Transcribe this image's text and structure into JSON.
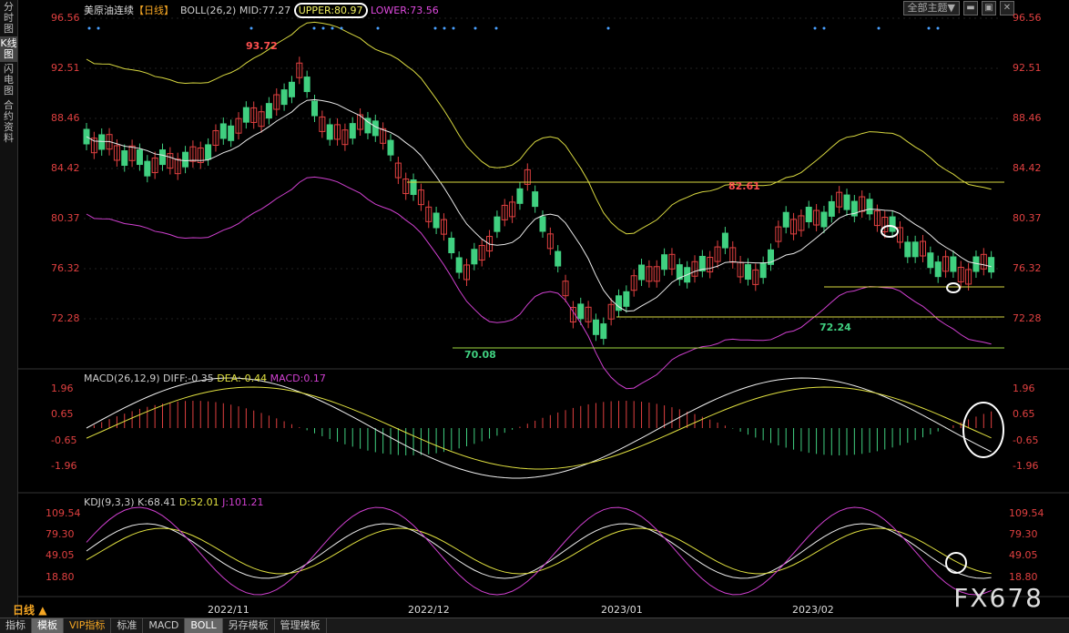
{
  "sidebar": [
    "分时图",
    "K线图",
    "闪电图",
    "合约资料"
  ],
  "header": {
    "symbol": "美原油连续",
    "period_tag": "【日线】",
    "boll": "BOLL(26,2)",
    "mid": "MID:77.27",
    "upper": "UPPER:80.97",
    "lower": "LOWER:73.56",
    "theme_btn": "全部主题▼"
  },
  "price_axis": [
    "96.56",
    "92.51",
    "88.46",
    "84.42",
    "80.37",
    "76.32",
    "72.28"
  ],
  "price_labels": {
    "high": "93.72",
    "mid_high": "82.61",
    "low": "70.08",
    "low2": "72.24"
  },
  "macd": {
    "title": "MACD(26,12,9)",
    "diff": "DIFF:-0.35",
    "dea": "DEA:-0.44",
    "macd": "MACD:0.17",
    "axis": [
      "1.96",
      "0.65",
      "-0.65",
      "-1.96"
    ]
  },
  "kdj": {
    "title": "KDJ(9,3,3)",
    "k": "K:68.41",
    "d": "D:52.01",
    "j": "J:101.21",
    "axis": [
      "109.54",
      "79.30",
      "49.05",
      "18.80"
    ]
  },
  "x_axis": [
    "2022/11",
    "2022/12",
    "2023/01",
    "2023/02"
  ],
  "period": "日线",
  "bottom_tabs": [
    "指标",
    "模板",
    "VIP指标",
    "标准",
    "MACD",
    "BOLL",
    "另存模板",
    "管理模板"
  ],
  "watermark": "FX678",
  "colors": {
    "up": "#e04040",
    "down": "#40d080",
    "mid": "#e8e8e8",
    "upper": "#d8d840",
    "lower": "#d040d0"
  }
}
